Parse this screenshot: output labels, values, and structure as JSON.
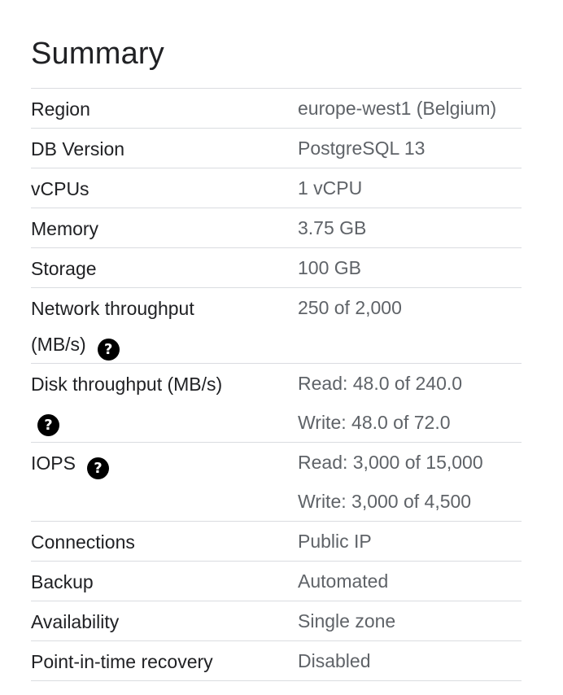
{
  "summary": {
    "title": "Summary",
    "help_glyph": "?",
    "help_icon": "help-circle-icon",
    "rows": [
      {
        "label": "Region",
        "value": "europe-west1 (Belgium)"
      },
      {
        "label": "DB Version",
        "value": "PostgreSQL 13"
      },
      {
        "label": "vCPUs",
        "value": "1 vCPU"
      },
      {
        "label": "Memory",
        "value": "3.75 GB"
      },
      {
        "label": "Storage",
        "value": "100 GB"
      },
      {
        "label_line1": "Network throughput",
        "label_line2": "(MB/s)",
        "value": "250 of 2,000",
        "has_help": true
      },
      {
        "label": "Disk throughput (MB/s)",
        "value_read": "Read: 48.0 of 240.0",
        "value_write": "Write: 48.0 of 72.0",
        "has_help": true
      },
      {
        "label": "IOPS",
        "value_read": "Read: 3,000 of 15,000",
        "value_write": "Write: 3,000 of 4,500",
        "has_help": true
      },
      {
        "label": "Connections",
        "value": "Public IP"
      },
      {
        "label": "Backup",
        "value": "Automated"
      },
      {
        "label": "Availability",
        "value": "Single zone"
      },
      {
        "label": "Point-in-time recovery",
        "value": "Disabled"
      }
    ]
  },
  "colors": {
    "label_text": "#202124",
    "value_text": "#5f6368",
    "divider": "#dadce0",
    "help_icon_bg": "#000000"
  }
}
